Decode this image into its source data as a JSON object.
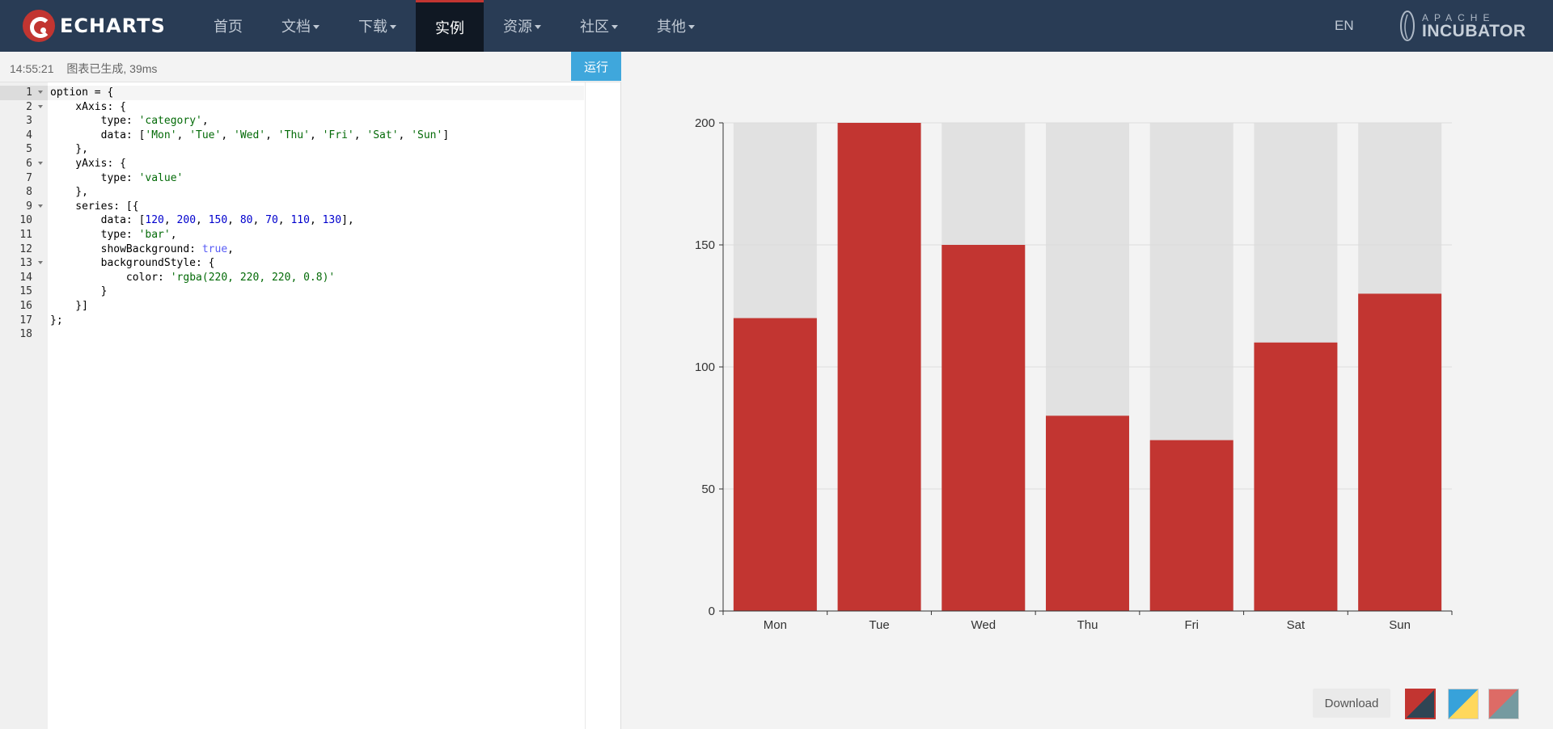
{
  "nav": {
    "logo_text": "ECHARTS",
    "items": [
      {
        "label": "首页",
        "has_caret": false,
        "active": false
      },
      {
        "label": "文档",
        "has_caret": true,
        "active": false
      },
      {
        "label": "下载",
        "has_caret": true,
        "active": false
      },
      {
        "label": "实例",
        "has_caret": false,
        "active": true
      },
      {
        "label": "资源",
        "has_caret": true,
        "active": false
      },
      {
        "label": "社区",
        "has_caret": true,
        "active": false
      },
      {
        "label": "其他",
        "has_caret": true,
        "active": false
      }
    ],
    "lang": "EN",
    "incubator_small": "APACHE",
    "incubator_big": "INCUBATOR"
  },
  "toolbar": {
    "time": "14:55:21",
    "status": "图表已生成, 39ms",
    "run_label": "运行"
  },
  "editor": {
    "line_numbers": [
      "1",
      "2",
      "3",
      "4",
      "5",
      "6",
      "7",
      "8",
      "9",
      "10",
      "11",
      "12",
      "13",
      "14",
      "15",
      "16",
      "17",
      "18"
    ],
    "fold_lines": [
      1,
      2,
      6,
      9,
      13
    ],
    "lines": [
      "option = {",
      "    xAxis: {",
      "        type: 'category',",
      "        data: ['Mon', 'Tue', 'Wed', 'Thu', 'Fri', 'Sat', 'Sun']",
      "    },",
      "    yAxis: {",
      "        type: 'value'",
      "    },",
      "    series: [{",
      "        data: [120, 200, 150, 80, 70, 110, 130],",
      "        type: 'bar',",
      "        showBackground: true,",
      "        backgroundStyle: {",
      "            color: 'rgba(220, 220, 220, 0.8)'",
      "        }",
      "    }]",
      "};",
      ""
    ]
  },
  "chart_data": {
    "type": "bar",
    "categories": [
      "Mon",
      "Tue",
      "Wed",
      "Thu",
      "Fri",
      "Sat",
      "Sun"
    ],
    "values": [
      120,
      200,
      150,
      80,
      70,
      110,
      130
    ],
    "ylim": [
      0,
      200
    ],
    "yticks": [
      "0",
      "50",
      "100",
      "150",
      "200"
    ],
    "yticks_values": [
      0,
      50,
      100,
      150,
      200
    ],
    "bar_color": "#c23531",
    "background_color": "rgba(220, 220, 220, 0.8)",
    "show_background": true,
    "grid": true,
    "legend": "none"
  },
  "controls": {
    "download_label": "Download",
    "themes": [
      {
        "name": "default-theme",
        "colors": [
          "#c23531",
          "#2f4554"
        ],
        "selected": true
      },
      {
        "name": "light-theme",
        "colors": [
          "#37a2da",
          "#ffd85c"
        ],
        "selected": false
      },
      {
        "name": "dark-theme",
        "colors": [
          "#dd6b66",
          "#759aa0"
        ],
        "selected": false
      }
    ]
  }
}
